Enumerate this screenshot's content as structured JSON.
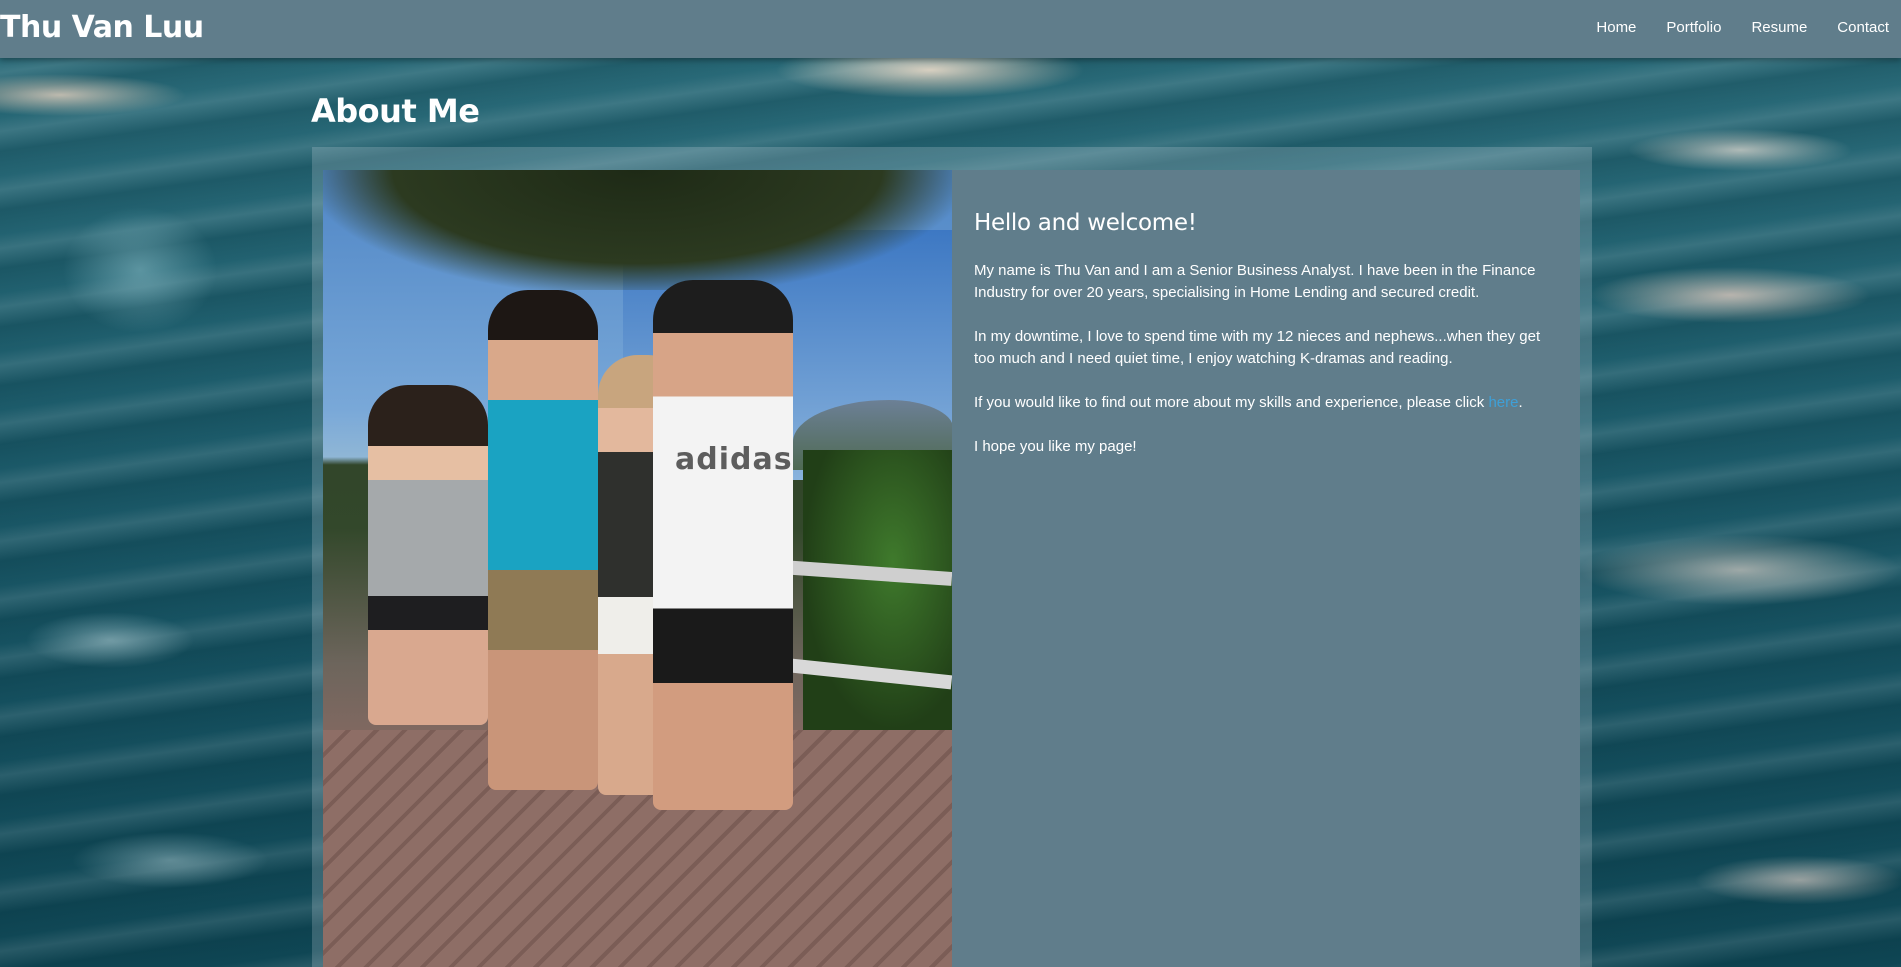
{
  "site": {
    "title": "Thu Van Luu"
  },
  "nav": {
    "items": [
      {
        "label": "Home"
      },
      {
        "label": "Portfolio"
      },
      {
        "label": "Resume"
      },
      {
        "label": "Contact"
      }
    ]
  },
  "page": {
    "heading": "About Me"
  },
  "about": {
    "photo_label": "adidas",
    "welcome": "Hello and welcome!",
    "paragraph1": "My name is Thu Van and I am a Senior Business Analyst. I have been in the Finance Industry for over 20 years, specialising in Home Lending and secured credit.",
    "paragraph2": "In my downtime, I love to spend time with my 12 nieces and nephews...when they get too much and I need quiet time, I enjoy watching K-dramas and reading.",
    "paragraph3_prefix": "If you would like to find out more about my skills and experience, please click ",
    "paragraph3_link": "here",
    "paragraph3_suffix": ".",
    "paragraph4": "I hope you like my page!"
  },
  "colors": {
    "navbar": "#607d8b",
    "panel": "#607d8b",
    "link": "#3ea0d8",
    "text": "#ffffff"
  }
}
